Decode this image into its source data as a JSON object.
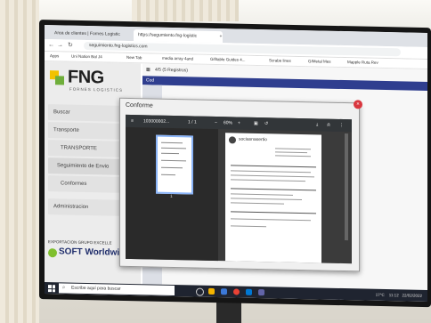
{
  "browser": {
    "tab1": "Area de clientes | Fornes Logistic",
    "tab2": "https://segumiento.fng-logistic",
    "url": "seguimiento.fng-logistics.com",
    "bookmarks": [
      "Apps",
      "Uni Nation Bal J4",
      "New Tab",
      "media array 4and",
      "Gifitable Guides 4...",
      "Scrabe lines",
      "GIMetal Mes",
      "Mapple Ruta Rev"
    ]
  },
  "sidebar": {
    "logo_text": "FNG",
    "logo_sub": "FORNES LOGISTICS",
    "menu": {
      "buscar": "Buscar",
      "transporte": "Transporte",
      "transporte_sub": "TRANSPORTE",
      "seguimiento": "Seguimiento de Envio",
      "conformes": "Conformes",
      "administracion": "Administracion"
    },
    "export": "EXPORTACION GRUPO EXCELLE",
    "soft": "SOFT Worldwide"
  },
  "content": {
    "records": "4/5 (5 Registros)",
    "col_header": "Cod"
  },
  "modal": {
    "title": "Conforme",
    "close": "×",
    "pdf": {
      "file": "103000002...",
      "pages": "1 / 1",
      "zoom": "60%",
      "doc_header": "sociasnasertio",
      "thumb_page": "1"
    }
  },
  "taskbar": {
    "search": "Escribe aquí para buscar",
    "weather": "17°C",
    "time": "11:12",
    "date": "22/02/2022"
  },
  "colors": {
    "accent_yellow": "#f2c200",
    "accent_green": "#6fae3b",
    "grid_header": "#2f3e8f",
    "close_red": "#d9363e"
  }
}
